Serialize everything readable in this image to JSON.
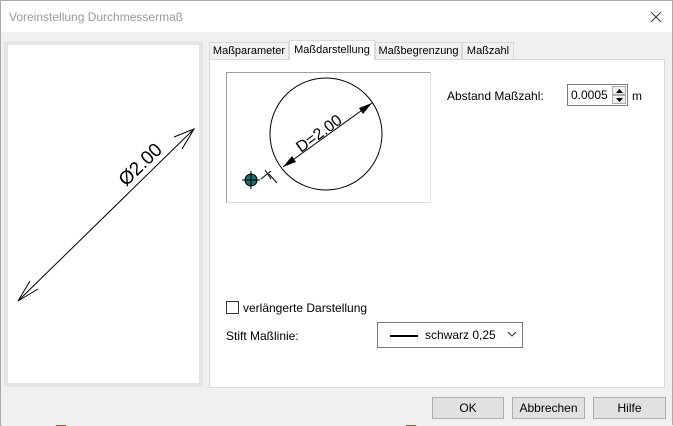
{
  "window": {
    "title": "Voreinstellung Durchmessermaß"
  },
  "preview": {
    "dimension_text": "Ø2.00"
  },
  "tabs": [
    {
      "label": "Maßparameter",
      "active": false
    },
    {
      "label": "Maßdarstellung",
      "active": true
    },
    {
      "label": "Maßbegrenzung",
      "active": false
    },
    {
      "label": "Maßzahl",
      "active": false
    }
  ],
  "panel": {
    "mini_preview_text": "D=2.00",
    "abstand_label": "Abstand Maßzahl:",
    "abstand_value": "0.0005",
    "abstand_unit": "m",
    "checkbox_label": "verlängerte Darstellung",
    "checkbox_checked": false,
    "stift_label": "Stift Maßlinie:",
    "stift_value": "schwarz 0,25"
  },
  "buttons": {
    "ok": "OK",
    "cancel": "Abbrechen",
    "help": "Hilfe"
  },
  "colors": {
    "accent_marker": "#1e6b6b",
    "window_bg": "#f0f0f0"
  }
}
